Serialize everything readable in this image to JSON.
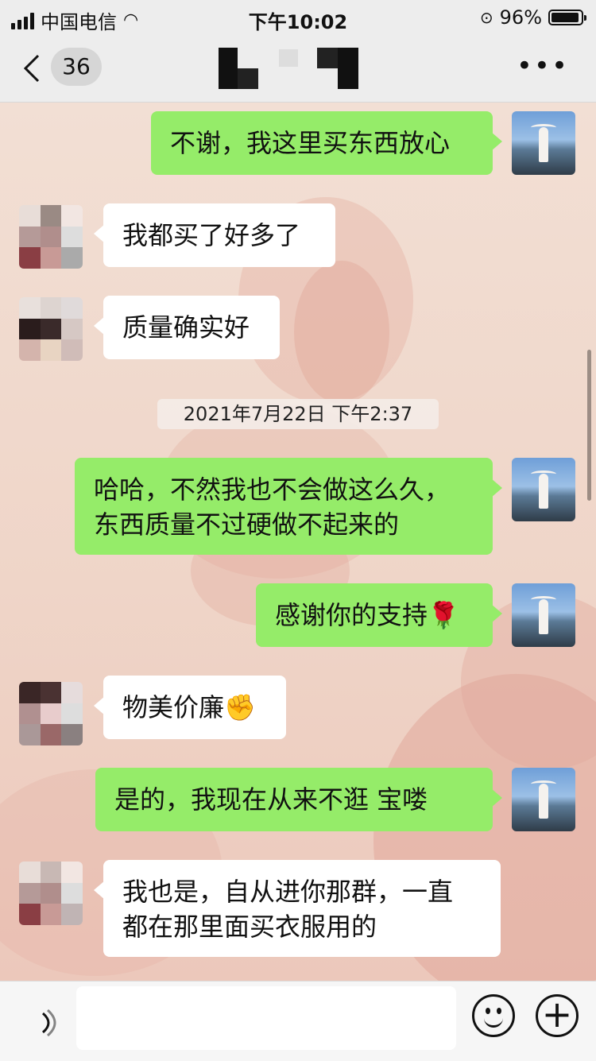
{
  "status_bar": {
    "carrier": "中国电信",
    "time": "下午10:02",
    "battery": "96%"
  },
  "nav": {
    "unread_count": "36",
    "title": "",
    "more_icon": "ellipsis-icon",
    "back_icon": "chevron-left-icon"
  },
  "messages": [
    {
      "side": "me",
      "text": "不谢，我这里买东西放心"
    },
    {
      "side": "other",
      "text": "我都买了好多了"
    },
    {
      "side": "other",
      "text": "质量确实好"
    },
    {
      "type": "timestamp",
      "text": "2021年7月22日 下午2:37"
    },
    {
      "side": "me",
      "text": "哈哈，不然我也不会做这么久，\n东西质量不过硬做不起来的"
    },
    {
      "side": "me",
      "text": "感谢你的支持🌹"
    },
    {
      "side": "other",
      "text": "物美价廉✊"
    },
    {
      "side": "me",
      "text": "是的，我现在从来不逛    宝喽"
    },
    {
      "side": "other",
      "text": "我也是，自从进你那群，一直\n都在那里面买衣服用的"
    }
  ],
  "input_bar": {
    "voice_icon": "voice-icon",
    "emoji_icon": "emoji-icon",
    "plus_icon": "plus-icon"
  },
  "colors": {
    "my_bubble": "#95ec69",
    "other_bubble": "#ffffff",
    "bar_background": "#ededed"
  }
}
